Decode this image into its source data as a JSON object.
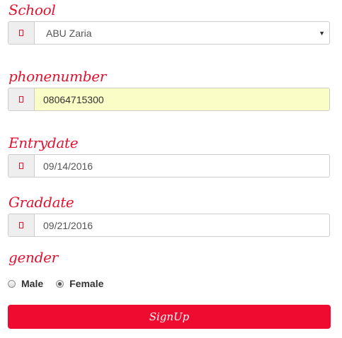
{
  "form": {
    "school": {
      "label": "School",
      "value": "ABU Zaria",
      "icon": "university-icon"
    },
    "phone": {
      "label": "phonenumber",
      "value": "08064715300",
      "icon": "phone-icon"
    },
    "entry": {
      "label": "Entrydate",
      "value": "09/14/2016",
      "icon": "calendar-icon"
    },
    "grad": {
      "label": "Graddate",
      "value": "09/21/2016",
      "icon": "calendar-icon"
    },
    "gender": {
      "label": "gender",
      "options": [
        "Male",
        "Female"
      ],
      "selected": "Female"
    },
    "submit_label": "SignUp"
  },
  "colors": {
    "accent": "#e0122f",
    "button": "#ef0b2f",
    "autofill": "#fbfdc6"
  }
}
